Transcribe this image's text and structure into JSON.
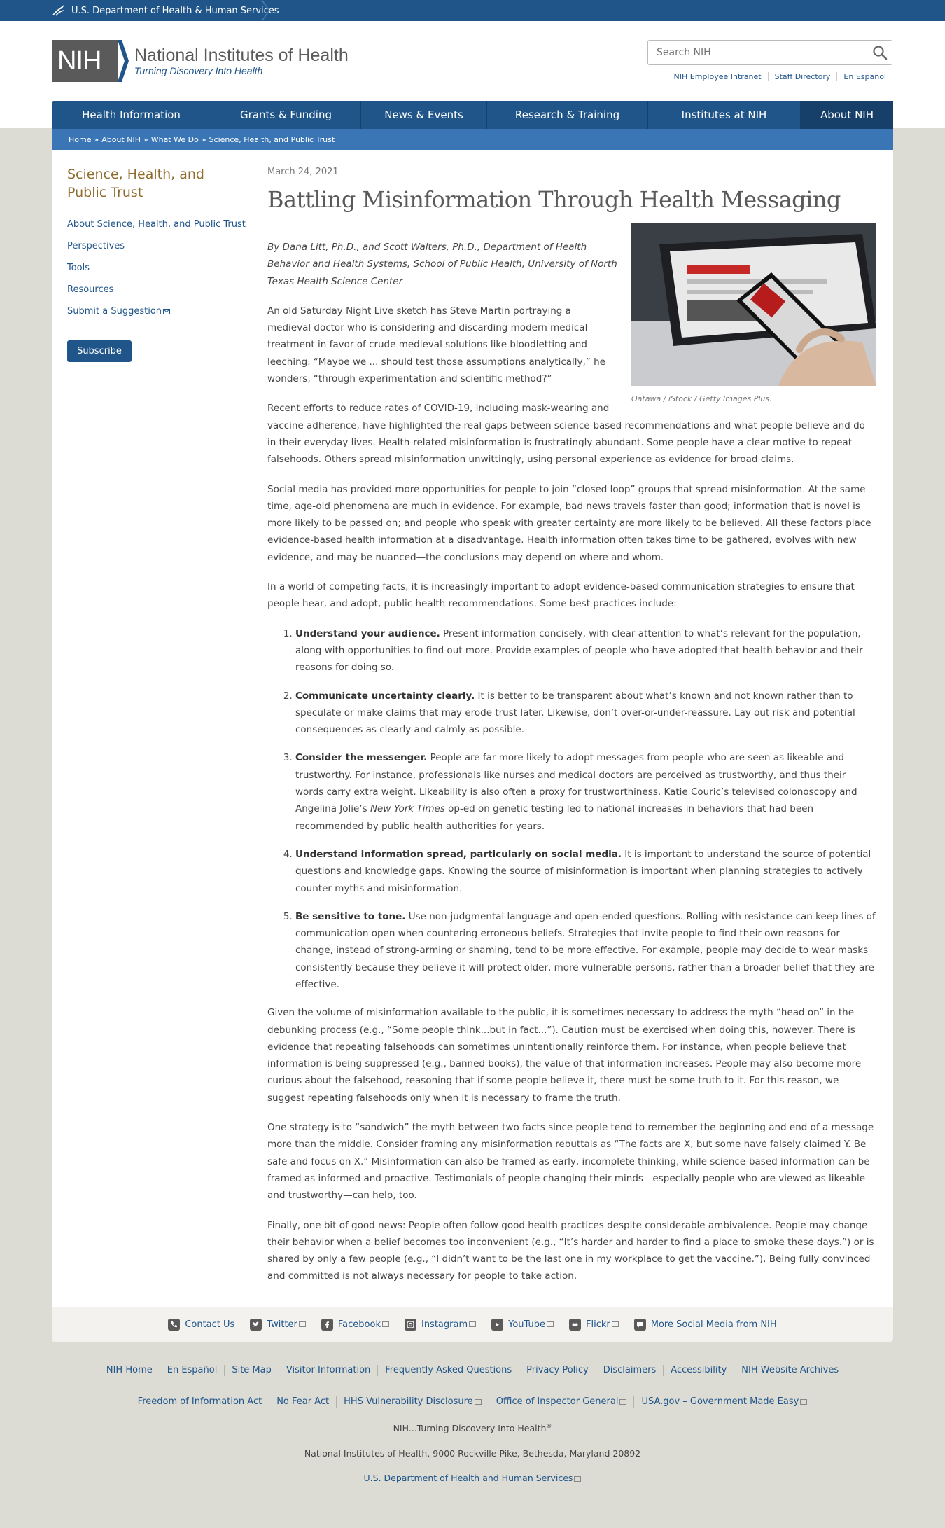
{
  "hhs_bar": {
    "label": "U.S. Department of Health & Human Services"
  },
  "header": {
    "logo_letters": "NIH",
    "logo_name": "National Institutes of Health",
    "logo_tagline": "Turning Discovery Into Health",
    "search_placeholder": "Search NIH",
    "utility_links": [
      "NIH Employee Intranet",
      "Staff Directory",
      "En Español"
    ]
  },
  "nav": {
    "items": [
      "Health Information",
      "Grants & Funding",
      "News & Events",
      "Research & Training",
      "Institutes at NIH",
      "About NIH"
    ],
    "active": "About NIH"
  },
  "breadcrumb": [
    "Home",
    "About NIH",
    "What We Do",
    "Science, Health, and Public Trust"
  ],
  "sidebar": {
    "title": "Science, Health, and Public Trust",
    "items": [
      "About Science, Health, and Public Trust",
      "Perspectives",
      "Tools",
      "Resources",
      "Submit a Suggestion"
    ],
    "subscribe_label": "Subscribe"
  },
  "article": {
    "date": "March 24, 2021",
    "title": "Battling Misinformation Through Health Messaging",
    "image_caption": "Oatawa / iStock / Getty Images Plus.",
    "byline": "By Dana Litt, Ph.D., and Scott Walters, Ph.D., Department of Health Behavior and Health Systems, School of Public Health, University of North Texas Health Science Center",
    "p1": "An old Saturday Night Live sketch has Steve Martin portraying a medieval doctor who is considering and discarding modern medical treatment in favor of crude medieval solutions like bloodletting and leeching. “Maybe we ... should test those assumptions analytically,” he wonders, “through experimentation and scientific method?”",
    "p2": "Recent efforts to reduce rates of COVID-19, including mask-wearing and vaccine adherence, have highlighted the real gaps between science-based recommendations and what people believe and do in their everyday lives. Health-related misinformation is frustratingly abundant. Some people have a clear motive to repeat falsehoods. Others spread misinformation unwittingly, using personal experience as evidence for broad claims.",
    "p3": "Social media has provided more opportunities for people to join “closed loop” groups that spread misinformation. At the same time, age-old phenomena are much in evidence. For example, bad news travels faster than good; information that is novel is more likely to be passed on; and people who speak with greater certainty are more likely to be believed. All these factors place evidence-based health information at a disadvantage. Health information often takes time to be gathered, evolves with new evidence, and may be nuanced—the conclusions may depend on where and whom.",
    "p4": "In a world of competing facts, it is increasingly important to adopt evidence-based communication strategies to ensure that people hear, and adopt, public health recommendations. Some best practices include:",
    "practices": [
      {
        "lead": "Understand your audience.",
        "text": " Present information concisely, with clear attention to what’s relevant for the population, along with opportunities to find out more. Provide examples of people who have adopted that health behavior and their reasons for doing so."
      },
      {
        "lead": "Communicate uncertainty clearly.",
        "text": " It is better to be transparent about what’s known and not known rather than to speculate or make claims that may erode trust later. Likewise, don’t over-or-under-reassure. Lay out risk and potential consequences as clearly and calmly as possible."
      },
      {
        "lead": "Consider the messenger.",
        "text_a": " People are far more likely to adopt messages from people who are seen as likeable and trustworthy. For instance, professionals like nurses and medical doctors are perceived as trustworthy, and thus their words carry extra weight. Likeability is also often a proxy for trustworthiness. Katie Couric’s televised colonoscopy and Angelina Jolie’s ",
        "em": "New York Times",
        "text_b": " op-ed on genetic testing led to national increases in behaviors that had been recommended by public health authorities for years."
      },
      {
        "lead": "Understand information spread, particularly on social media.",
        "text": " It is important to understand the source of potential questions and knowledge gaps. Knowing the source of misinformation is important when planning strategies to actively counter myths and misinformation."
      },
      {
        "lead": "Be sensitive to tone.",
        "text": " Use non-judgmental language and open-ended questions. Rolling with resistance can keep lines of communication open when countering erroneous beliefs. Strategies that invite people to find their own reasons for change, instead of strong-arming or shaming, tend to be more effective. For example, people may decide to wear masks consistently because they believe it will protect older, more vulnerable persons, rather than a broader belief that they are effective."
      }
    ],
    "p5": "Given the volume of misinformation available to the public, it is sometimes necessary to address the myth “head on” in the debunking process (e.g., “Some people think...but in fact...”). Caution must be exercised when doing this, however. There is evidence that repeating falsehoods can sometimes unintentionally reinforce them. For instance, when people believe that information is being suppressed (e.g., banned books), the value of that information increases. People may also become more curious about the falsehood, reasoning that if some people believe it, there must be some truth to it. For this reason, we suggest repeating falsehoods only when it is necessary to frame the truth.",
    "p6": "One strategy is to “sandwich” the myth between two facts since people tend to remember the beginning and end of a message more than the middle. Consider framing any misinformation rebuttals as “The facts are X, but some have falsely claimed Y. Be safe and focus on X.” Misinformation can also be framed as early, incomplete thinking, while science-based information can be framed as informed and proactive. Testimonials of people changing their minds—especially people who are viewed as likeable and trustworthy—can help, too.",
    "p7": "Finally, one bit of good news: People often follow good health practices despite considerable ambivalence. People may change their behavior when a belief becomes too inconvenient (e.g., “It’s harder and harder to find a place to smoke these days.”) or is shared by only a few people (e.g., “I didn’t want to be the last one in my workplace to get the vaccine.”). Being fully convinced and committed is not always necessary for people to take action."
  },
  "social": {
    "items": [
      {
        "label": "Contact Us",
        "icon": "phone-icon"
      },
      {
        "label": "Twitter",
        "icon": "twitter-icon"
      },
      {
        "label": "Facebook",
        "icon": "facebook-icon"
      },
      {
        "label": "Instagram",
        "icon": "instagram-icon"
      },
      {
        "label": "YouTube",
        "icon": "youtube-icon"
      },
      {
        "label": "Flickr",
        "icon": "flickr-icon"
      },
      {
        "label": "More Social Media from NIH",
        "icon": "chat-icon"
      }
    ]
  },
  "footer": {
    "row1": [
      "NIH Home",
      "En Español",
      "Site Map",
      "Visitor Information",
      "Frequently Asked Questions",
      "Privacy Policy",
      "Disclaimers",
      "Accessibility",
      "NIH Website Archives"
    ],
    "row2": [
      "Freedom of Information Act",
      "No Fear Act",
      "HHS Vulnerability Disclosure",
      "Office of Inspector General",
      "USA.gov – Government Made Easy"
    ],
    "tagline": "NIH...Turning Discovery Into Health",
    "trademark": "®",
    "address": "National Institutes of Health, 9000 Rockville Pike, Bethesda, Maryland 20892",
    "hhs": "U.S. Department of Health and Human Services"
  },
  "colors": {
    "brand_blue": "#20558a",
    "breadcrumb_blue": "#3a75b5",
    "sidebar_title": "#8f6b2c",
    "page_bg": "#dcdcd5"
  }
}
